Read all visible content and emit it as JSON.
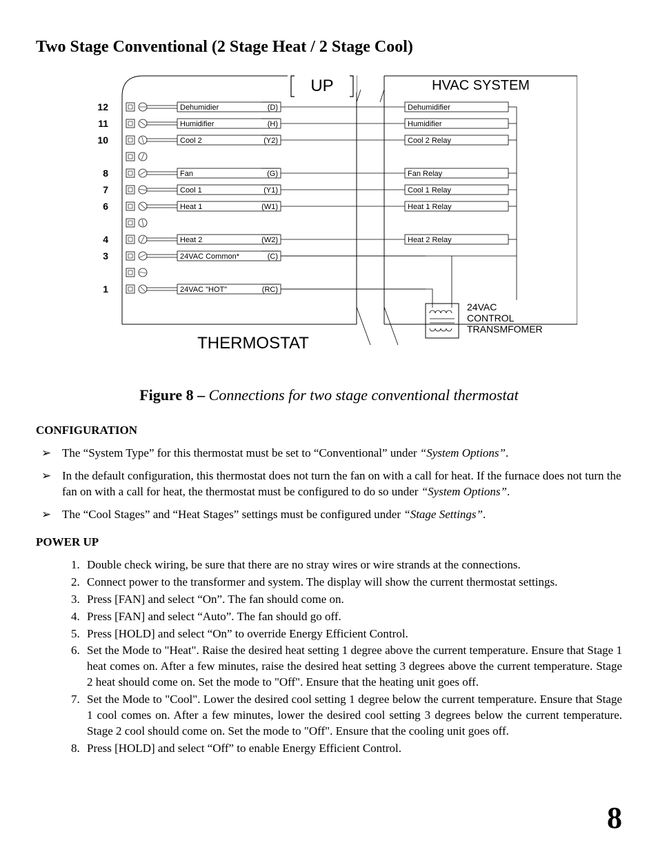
{
  "title": "Two Stage Conventional (2 Stage Heat / 2 Stage Cool)",
  "figure": {
    "caption_bold": "Figure 8 – ",
    "caption_italic": "Connections for two stage conventional thermostat",
    "up_label": "UP",
    "hvac_label": "HVAC SYSTEM",
    "thermostat_label": "THERMOSTAT",
    "transformer_l1": "24VAC",
    "transformer_l2": "CONTROL",
    "transformer_l3": "TRANSMFOMER"
  },
  "terminals": [
    {
      "num": "12",
      "left": "Dehumidier",
      "code": "(D)",
      "right": "Dehumidifier"
    },
    {
      "num": "11",
      "left": "Humidifier",
      "code": "(H)",
      "right": "Humidifier"
    },
    {
      "num": "10",
      "left": "Cool 2",
      "code": "(Y2)",
      "right": "Cool 2 Relay"
    },
    {
      "num": "",
      "left": "",
      "code": "",
      "right": ""
    },
    {
      "num": "8",
      "left": "Fan",
      "code": "(G)",
      "right": "Fan Relay"
    },
    {
      "num": "7",
      "left": "Cool 1",
      "code": "(Y1)",
      "right": "Cool 1 Relay"
    },
    {
      "num": "6",
      "left": "Heat 1",
      "code": "(W1)",
      "right": "Heat 1 Relay"
    },
    {
      "num": "",
      "left": "",
      "code": "",
      "right": ""
    },
    {
      "num": "4",
      "left": "Heat 2",
      "code": "(W2)",
      "right": "Heat 2 Relay"
    },
    {
      "num": "3",
      "left": "24VAC Common*",
      "code": "(C)",
      "right": ""
    },
    {
      "num": "",
      "left": "",
      "code": "",
      "right": ""
    },
    {
      "num": "1",
      "left": "24VAC \"HOT\"",
      "code": "(RC)",
      "right": ""
    }
  ],
  "config": {
    "heading": "CONFIGURATION",
    "items": [
      {
        "pre": "The “System Type” for this thermostat must be set to “Conventional” under ",
        "it": "“System Options”",
        "post": "."
      },
      {
        "pre": "In the default configuration, this thermostat does not turn the fan on with a call for heat.  If the furnace does not turn the fan on with a call for heat, the thermostat must be configured to do so under ",
        "it": "“System Options”",
        "post": "."
      },
      {
        "pre": "The “Cool Stages” and “Heat Stages” settings must be configured under ",
        "it": "“Stage Settings”",
        "post": "."
      }
    ]
  },
  "powerup": {
    "heading": "POWER UP",
    "items": [
      "Double check wiring, be sure that there are no stray wires or wire strands at the connections.",
      "Connect power to the transformer and system.  The display will show the current thermostat settings.",
      "Press [FAN] and select “On”.  The fan should come on.",
      "Press [FAN] and select “Auto”.  The fan should go off.",
      "Press [HOLD] and select “On” to override Energy Efficient Control.",
      "Set the Mode to \"Heat\".  Raise the desired heat setting 1 degree above the current temperature.  Ensure that Stage 1 heat comes on.  After a few minutes, raise the desired heat setting 3 degrees above the current temperature.  Stage 2 heat should come on.  Set the mode to \"Off\".  Ensure that the heating unit goes off.",
      "Set the Mode to \"Cool\".  Lower the desired cool setting 1 degree below the current temperature.  Ensure that Stage 1 cool comes on.  After a few minutes, lower the desired cool setting 3 degrees below the current temperature.  Stage 2 cool should come on.  Set the mode to \"Off\".  Ensure that the cooling unit goes off.",
      "Press [HOLD] and select “Off” to enable Energy Efficient Control."
    ]
  },
  "page_number": "8"
}
